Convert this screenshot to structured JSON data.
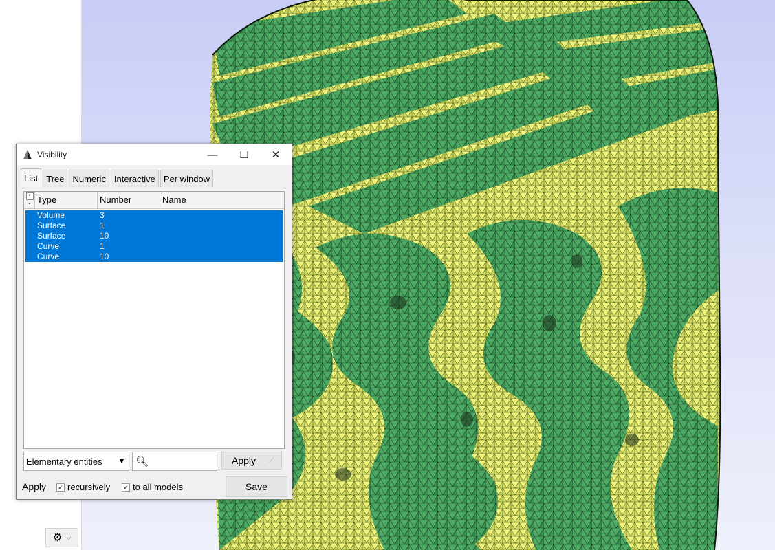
{
  "dialog": {
    "title": "Visibility",
    "tabs": [
      {
        "label": "List",
        "active": true
      },
      {
        "label": "Tree",
        "active": false
      },
      {
        "label": "Numeric",
        "active": false
      },
      {
        "label": "Interactive",
        "active": false
      },
      {
        "label": "Per window",
        "active": false
      }
    ],
    "list": {
      "corner": {
        "top": "*",
        "bottom": "-"
      },
      "columns": [
        "Type",
        "Number",
        "Name"
      ],
      "rows": [
        {
          "type": "Volume",
          "number": "3",
          "name": ""
        },
        {
          "type": "Surface",
          "number": "1",
          "name": ""
        },
        {
          "type": "Surface",
          "number": "10",
          "name": ""
        },
        {
          "type": "Curve",
          "number": "1",
          "name": ""
        },
        {
          "type": "Curve",
          "number": "10",
          "name": ""
        }
      ],
      "selection_color": "#0078d7"
    },
    "entity_select": {
      "value": "Elementary entities"
    },
    "search": {
      "value": ""
    },
    "apply_button": "Apply",
    "bottom": {
      "apply_label": "Apply",
      "recursively": {
        "label": "recursively",
        "checked": true
      },
      "to_all_models": {
        "label": "to all models",
        "checked": true
      },
      "save_button": "Save"
    }
  },
  "viewport": {
    "mesh_dark": "#2f8a4e",
    "mesh_light": "#e6ec6a",
    "background_top": "#c9cdf6"
  },
  "icons": {
    "app_icon": "gmsh-logo-icon",
    "settings": "gear-icon"
  }
}
